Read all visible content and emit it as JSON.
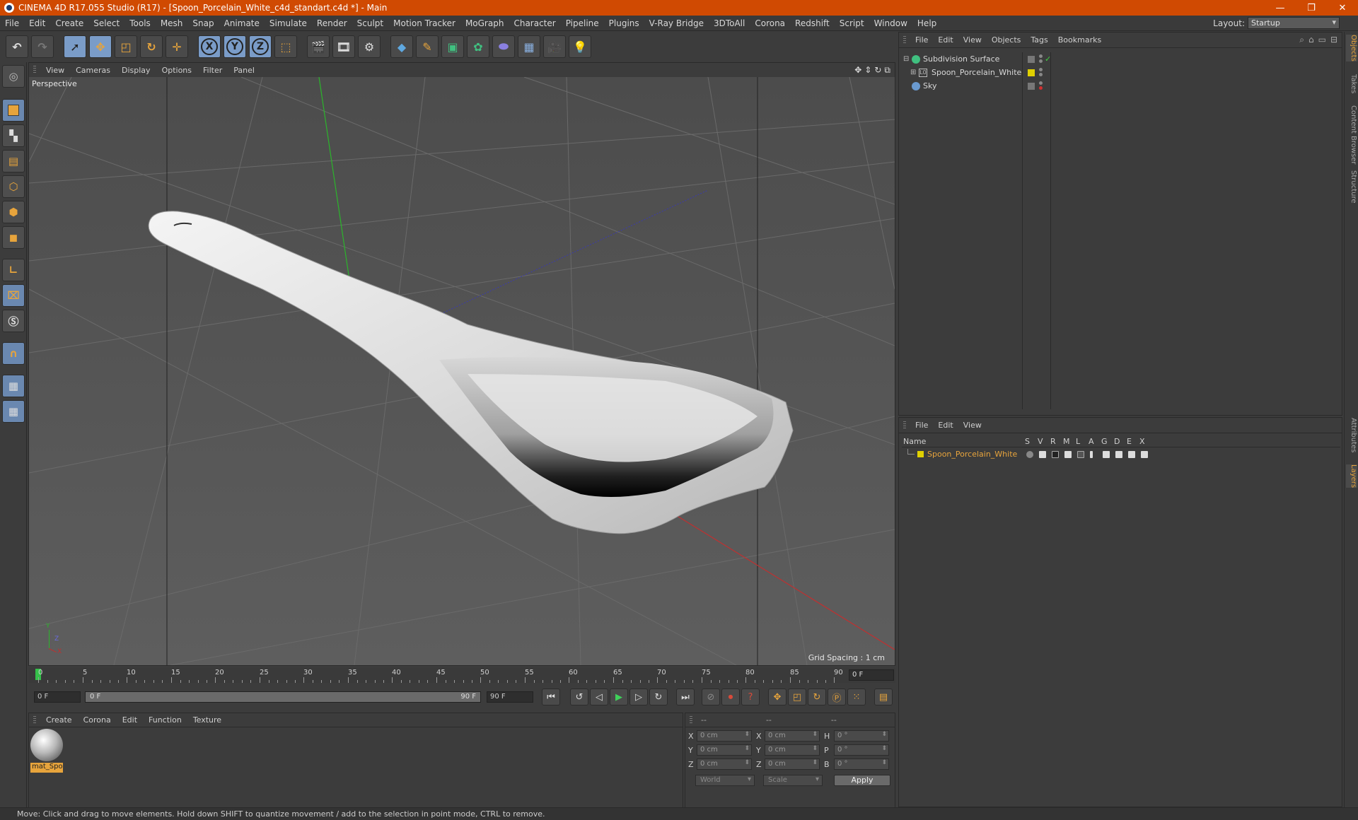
{
  "window": {
    "title": "CINEMA 4D R17.055 Studio (R17) - [Spoon_Porcelain_White_c4d_standart.c4d *] - Main",
    "controls": [
      "—",
      "❐",
      "✕"
    ]
  },
  "menubar": {
    "items": [
      "File",
      "Edit",
      "Create",
      "Select",
      "Tools",
      "Mesh",
      "Snap",
      "Animate",
      "Simulate",
      "Render",
      "Sculpt",
      "Motion Tracker",
      "MoGraph",
      "Character",
      "Pipeline",
      "Plugins",
      "V-Ray Bridge",
      "3DToAll",
      "Corona",
      "Redshift",
      "Script",
      "Window",
      "Help"
    ],
    "layout_label": "Layout:",
    "layout_value": "Startup"
  },
  "toolbar": {
    "axis_labels": [
      "X",
      "Y",
      "Z"
    ]
  },
  "viewport": {
    "menu": [
      "View",
      "Cameras",
      "Display",
      "Options",
      "Filter",
      "Panel"
    ],
    "label": "Perspective",
    "grid_spacing": "Grid Spacing : 1 cm",
    "axis_gizmo": [
      "Y",
      "Z",
      "X"
    ]
  },
  "timeline": {
    "ticks": [
      "0",
      "5",
      "10",
      "15",
      "20",
      "25",
      "30",
      "35",
      "40",
      "45",
      "50",
      "55",
      "60",
      "65",
      "70",
      "75",
      "80",
      "85",
      "90"
    ],
    "current_frame": "0 F"
  },
  "transport": {
    "start_field": "0 F",
    "range_start": "0 F",
    "range_end": "90 F",
    "end_field": "90 F"
  },
  "material_manager": {
    "menu": [
      "Create",
      "Corona",
      "Edit",
      "Function",
      "Texture"
    ],
    "material_name": "mat_Spo"
  },
  "coordinates": {
    "header": [
      "--",
      "--",
      "--"
    ],
    "rows": [
      {
        "a1": "X",
        "v1": "0 cm",
        "a2": "X",
        "v2": "0 cm",
        "a3": "H",
        "v3": "0 °"
      },
      {
        "a1": "Y",
        "v1": "0 cm",
        "a2": "Y",
        "v2": "0 cm",
        "a3": "P",
        "v3": "0 °"
      },
      {
        "a1": "Z",
        "v1": "0 cm",
        "a2": "Z",
        "v2": "0 cm",
        "a3": "B",
        "v3": "0 °"
      }
    ],
    "space": "World",
    "mode": "Scale",
    "apply": "Apply"
  },
  "objects_panel": {
    "menu": [
      "File",
      "Edit",
      "View",
      "Objects",
      "Tags",
      "Bookmarks"
    ],
    "items": [
      {
        "name": "Subdivision Surface"
      },
      {
        "name": "Spoon_Porcelain_White"
      },
      {
        "name": "Sky"
      }
    ]
  },
  "layers_panel": {
    "menu": [
      "File",
      "Edit",
      "View"
    ],
    "columns": [
      "Name",
      "S",
      "V",
      "R",
      "M",
      "L",
      "A",
      "G",
      "D",
      "E",
      "X"
    ],
    "layer_name": "Spoon_Porcelain_White",
    "layer_color": "#e0d000"
  },
  "side_tabs": [
    "Objects",
    "Takes",
    "Content Browser",
    "Structure",
    "Attributes",
    "Layers"
  ],
  "statusbar": {
    "text": "Move: Click and drag to move elements. Hold down SHIFT to quantize movement / add to the selection in point mode, CTRL to remove."
  },
  "colors": {
    "titlebar": "#d04a02",
    "accent": "#e7a43c",
    "panel": "#3c3c3c",
    "viewport_bg": "#535353"
  }
}
